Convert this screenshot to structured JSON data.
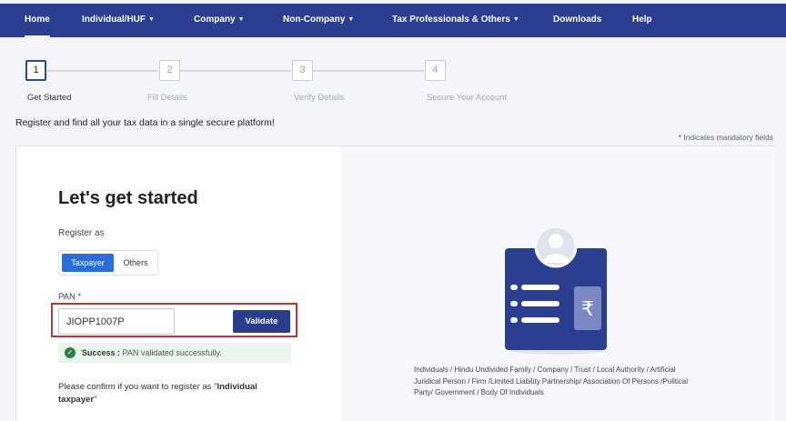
{
  "nav": {
    "items": [
      {
        "label": "Home",
        "caret": false
      },
      {
        "label": "Individual/HUF",
        "caret": true
      },
      {
        "label": "Company",
        "caret": true
      },
      {
        "label": "Non-Company",
        "caret": true
      },
      {
        "label": "Tax Professionals & Others",
        "caret": true
      },
      {
        "label": "Downloads",
        "caret": false
      },
      {
        "label": "Help",
        "caret": false
      }
    ]
  },
  "stepper": {
    "steps": [
      {
        "number": "1",
        "label": "Get Started",
        "active": true
      },
      {
        "number": "2",
        "label": "Fill Details",
        "active": false
      },
      {
        "number": "3",
        "label": "Verify Details",
        "active": false
      },
      {
        "number": "4",
        "label": "Secure Your Account",
        "active": false
      }
    ]
  },
  "tagline": "Register and find all your tax data in a single secure platform!",
  "mandatory_note": "* Indicates mandatory fields",
  "form": {
    "title": "Let's get started",
    "register_as_label": "Register as",
    "toggle": {
      "selected": "Taxpayer",
      "options": [
        "Taxpayer",
        "Others"
      ]
    },
    "pan_label": "PAN *",
    "pan_value": "JIOPP1007P",
    "validate_label": "Validate",
    "success_label": "Success :",
    "success_message": " PAN validated successfully.",
    "confirm_prefix": "Please confirm if you want to register as \"",
    "confirm_type": "Individual taxpayer",
    "confirm_suffix": "\""
  },
  "entities_text": "Individuals / Hindu Undivided Family / Company / Trust / Local Authority / Artificial Juridical Person / Firm /Limited Liability Partnership/ Association Of Persons /Political Party/ Government / Body Of Individuals",
  "colors": {
    "nav_bg": "#2c3e8f",
    "primary": "#2b3e8c",
    "toggle_active": "#2c6ed5",
    "success_bg": "#eaf6ec",
    "success_icon": "#2e7d46",
    "highlight": "#b23a3a"
  },
  "icons": {
    "success": "check-circle-icon",
    "illustration": "id-card-rupee-icon",
    "caret": "caret-down-icon"
  }
}
